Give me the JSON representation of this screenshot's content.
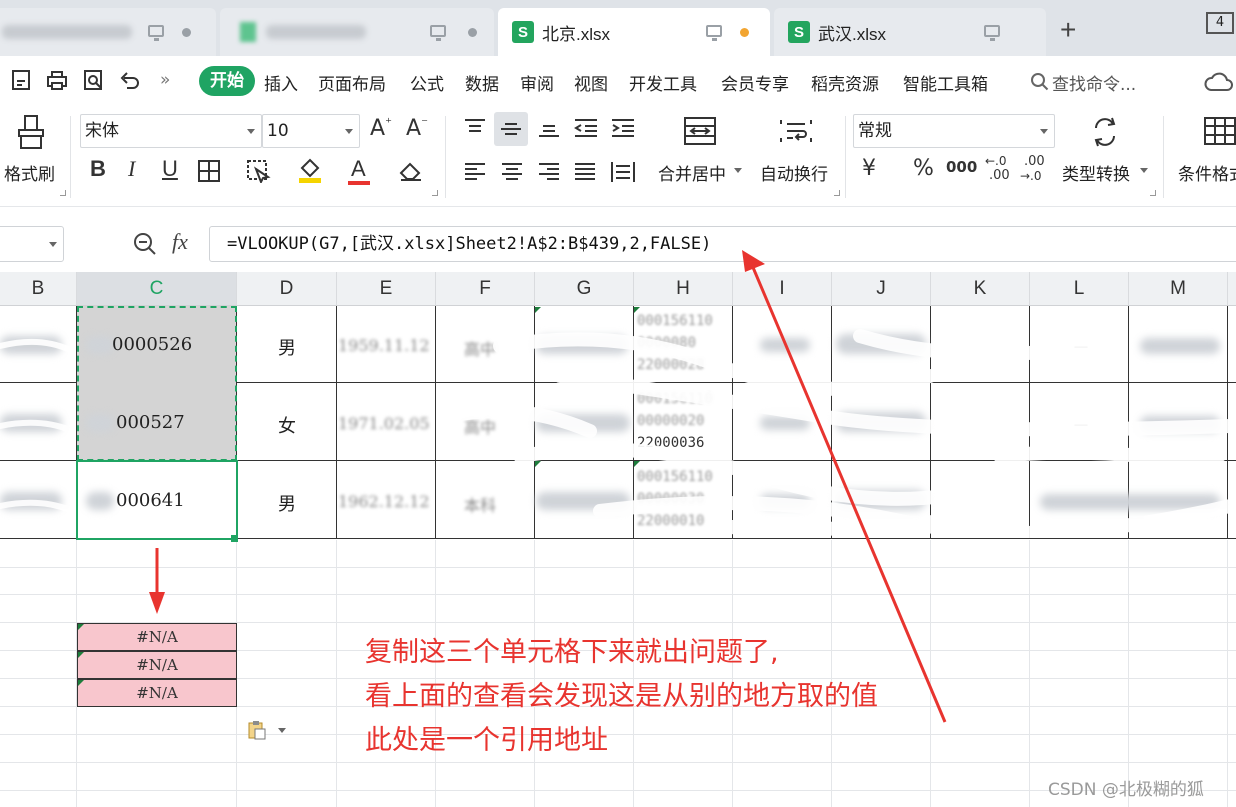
{
  "tabs": [
    {
      "name": "",
      "blurred": true,
      "active": false
    },
    {
      "name": "",
      "blurred": true,
      "active": false
    },
    {
      "name": "北京.xlsx",
      "blurred": false,
      "active": true,
      "modified": true
    },
    {
      "name": "武汉.xlsx",
      "blurred": false,
      "active": false
    }
  ],
  "tab_icon_letter": "S",
  "window_count": "4",
  "menu": {
    "more": "»",
    "items": [
      "开始",
      "插入",
      "页面布局",
      "公式",
      "数据",
      "审阅",
      "视图",
      "开发工具",
      "会员专享",
      "稻壳资源",
      "智能工具箱"
    ],
    "search": "查找命令..."
  },
  "ribbon": {
    "format_painter": "格式刷",
    "font_name": "宋体",
    "font_size": "10",
    "grow_font": "A",
    "shrink_font": "A",
    "bold": "B",
    "italic": "I",
    "underline": "U",
    "font_color_letter": "A",
    "merge_center": "合并居中",
    "wrap_text": "自动换行",
    "number_format": "常规",
    "currency": "¥",
    "percent": "%",
    "thousands": "000",
    "dec_inc": ".00",
    "dec_dec": ".00",
    "type_convert": "类型转换",
    "cond_format": "条件格式"
  },
  "formula_bar": {
    "fx": "fx",
    "formula": "=VLOOKUP(G7,[武汉.xlsx]Sheet2!A$2:B$439,2,FALSE)"
  },
  "columns": [
    "B",
    "C",
    "D",
    "E",
    "F",
    "G",
    "H",
    "I",
    "J",
    "K",
    "L",
    "M"
  ],
  "selected_column": "C",
  "rows": [
    {
      "c": "0000526",
      "d": "男",
      "e": "1959.11.12",
      "f": "高中",
      "h": [
        "000156110",
        "0000080",
        "22000028"
      ],
      "l": "－"
    },
    {
      "c": "000527",
      "d": "女",
      "e": "1971.02.05",
      "f": "高中",
      "h": [
        "000156110",
        "00000020",
        "22000036"
      ],
      "l": "－"
    },
    {
      "c": "000641",
      "d": "男",
      "e": "1962.12.12",
      "f": "本科",
      "h": [
        "000156110",
        "00000030",
        "22000010"
      ],
      "l": ""
    }
  ],
  "na_cells": [
    "#N/A",
    "#N/A",
    "#N/A"
  ],
  "annotation": [
    "复制这三个单元格下来就出问题了,",
    "看上面的查看会发现这是从别的地方取的值",
    "此处是一个引用地址"
  ],
  "watermark": "CSDN @北极糊的狐",
  "colors": {
    "accent": "#1fa463",
    "annotation": "#e8342f",
    "na_fill": "#f8c6cd",
    "selection": "#1fa463"
  }
}
